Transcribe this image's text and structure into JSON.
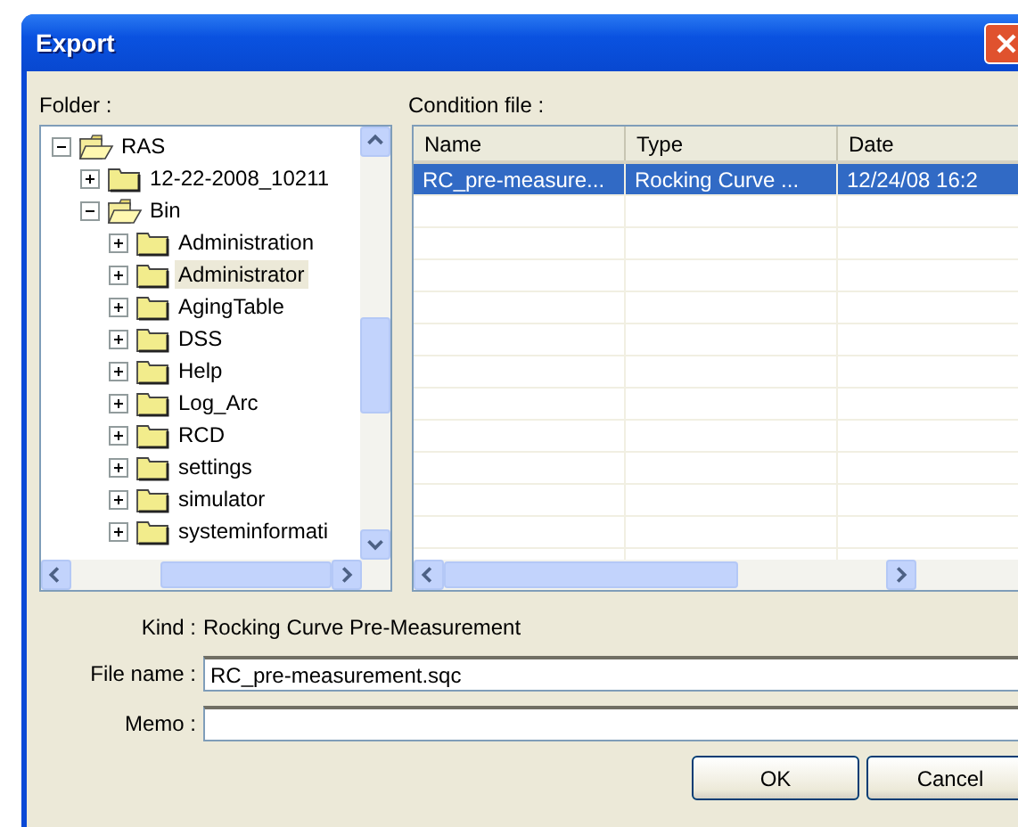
{
  "window": {
    "title": "Export"
  },
  "folder_label": "Folder :",
  "condition_label": "Condition file :",
  "tree": [
    {
      "label": "RAS",
      "expanded": true,
      "selected": false,
      "children": [
        {
          "label": "12-22-2008_10211",
          "expanded": false,
          "selected": false
        },
        {
          "label": "Bin",
          "expanded": true,
          "selected": false,
          "children": [
            {
              "label": "Administration",
              "expanded": false,
              "selected": false
            },
            {
              "label": "Administrator",
              "expanded": false,
              "selected": true
            },
            {
              "label": "AgingTable",
              "expanded": false,
              "selected": false
            },
            {
              "label": "DSS",
              "expanded": false,
              "selected": false
            },
            {
              "label": "Help",
              "expanded": false,
              "selected": false
            },
            {
              "label": "Log_Arc",
              "expanded": false,
              "selected": false
            },
            {
              "label": "RCD",
              "expanded": false,
              "selected": false
            },
            {
              "label": "settings",
              "expanded": false,
              "selected": false
            },
            {
              "label": "simulator",
              "expanded": false,
              "selected": false
            },
            {
              "label": "systeminformati",
              "expanded": false,
              "selected": false
            }
          ]
        }
      ]
    }
  ],
  "files": {
    "columns": [
      "Name",
      "Type",
      "Date"
    ],
    "rows": [
      {
        "cells": [
          "RC_pre-measure...",
          "Rocking Curve ...",
          "12/24/08 16:2"
        ],
        "selected": true
      }
    ]
  },
  "kind": {
    "label": "Kind :",
    "value": "Rocking Curve Pre-Measurement"
  },
  "file_name": {
    "label": "File name :",
    "value": "RC_pre-measurement.sqc"
  },
  "memo": {
    "label": "Memo :"
  },
  "buttons": [
    "OK",
    "Cancel"
  ]
}
